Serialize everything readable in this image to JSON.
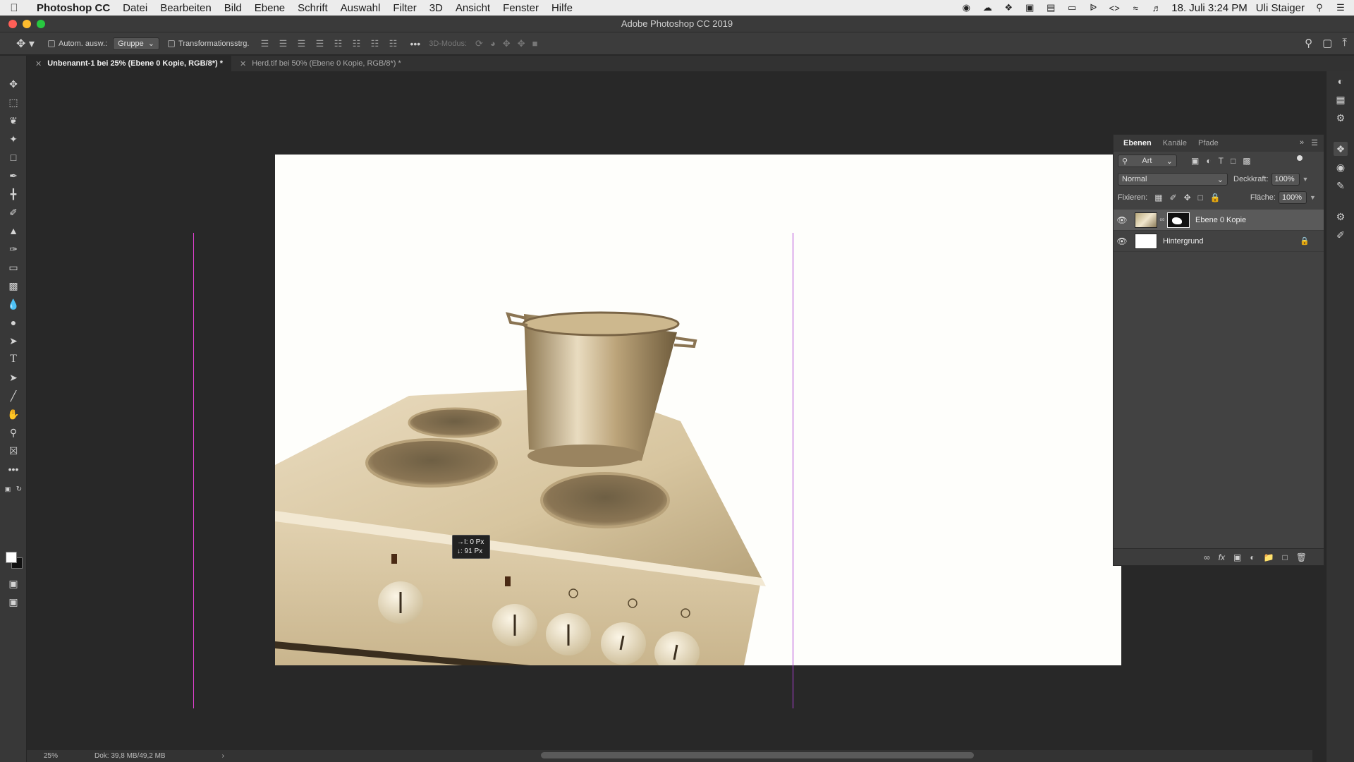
{
  "menubar": {
    "app_name": "Photoshop CC",
    "items": [
      "Datei",
      "Bearbeiten",
      "Bild",
      "Ebene",
      "Schrift",
      "Auswahl",
      "Filter",
      "3D",
      "Ansicht",
      "Fenster",
      "Hilfe"
    ],
    "date_time": "18. Juli  3:24 PM",
    "user": "Uli Staiger"
  },
  "window": {
    "title": "Adobe Photoshop CC 2019"
  },
  "options": {
    "auto_select_label": "Autom. ausw.:",
    "auto_select_value": "Gruppe",
    "transform_label": "Transformationsstrg.",
    "mode_3d_label": "3D-Modus:"
  },
  "tabs": [
    {
      "label": "Unbenannt-1 bei 25% (Ebene 0 Kopie, RGB/8*) *",
      "active": true
    },
    {
      "label": "Herd.tif bei 50% (Ebene 0 Kopie, RGB/8*) *",
      "active": false
    }
  ],
  "canvas": {
    "measure_x": "→I:  0 Px",
    "measure_y": "↓: 91 Px"
  },
  "status": {
    "zoom": "25%",
    "doc_info": "Dok: 39,8 MB/49,2 MB",
    "arrow": "›"
  },
  "layers_panel": {
    "tabs": [
      "Ebenen",
      "Kanäle",
      "Pfade"
    ],
    "filter_label": "Art",
    "blend_mode": "Normal",
    "opacity_label": "Deckkraft:",
    "opacity_value": "100%",
    "lock_label": "Fixieren:",
    "fill_label": "Fläche:",
    "fill_value": "100%",
    "layers": [
      {
        "name": "Ebene 0 Kopie",
        "selected": true,
        "has_mask": true,
        "locked": false
      },
      {
        "name": "Hintergrund",
        "selected": false,
        "has_mask": false,
        "locked": true
      }
    ]
  },
  "colors": {
    "guide_magenta": "#e040d0",
    "guide_violet": "#b040d8",
    "foreground": "#ffffff",
    "background": "#111111"
  }
}
